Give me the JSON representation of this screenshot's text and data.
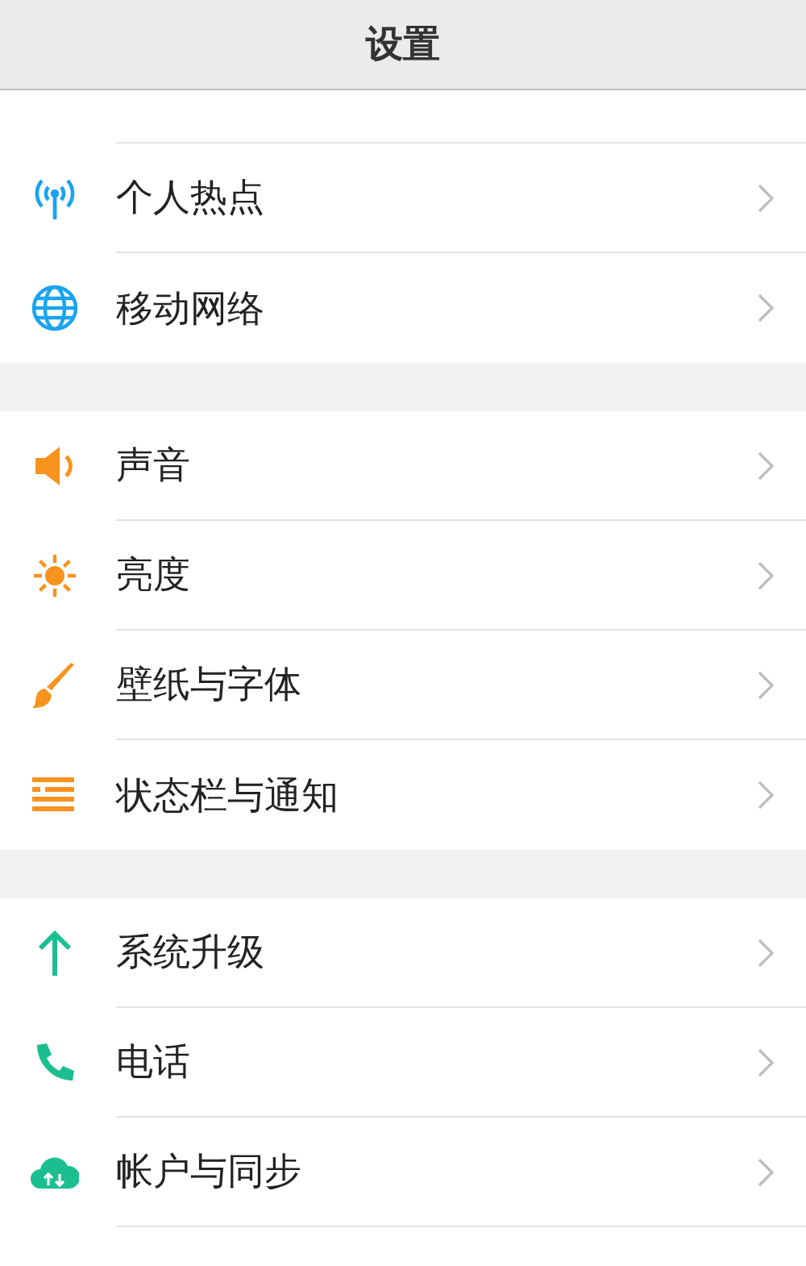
{
  "header": {
    "title": "设置"
  },
  "groups": [
    {
      "items": [
        {
          "kind": "hotspot",
          "label": "个人热点"
        },
        {
          "kind": "globe",
          "label": "移动网络"
        }
      ]
    },
    {
      "items": [
        {
          "kind": "sound",
          "label": "声音"
        },
        {
          "kind": "brightness",
          "label": "亮度"
        },
        {
          "kind": "brush",
          "label": "壁纸与字体"
        },
        {
          "kind": "statusbar",
          "label": "状态栏与通知"
        }
      ]
    },
    {
      "items": [
        {
          "kind": "upgrade",
          "label": "系统升级"
        },
        {
          "kind": "phone",
          "label": "电话"
        },
        {
          "kind": "cloud",
          "label": "帐户与同步"
        }
      ]
    }
  ]
}
